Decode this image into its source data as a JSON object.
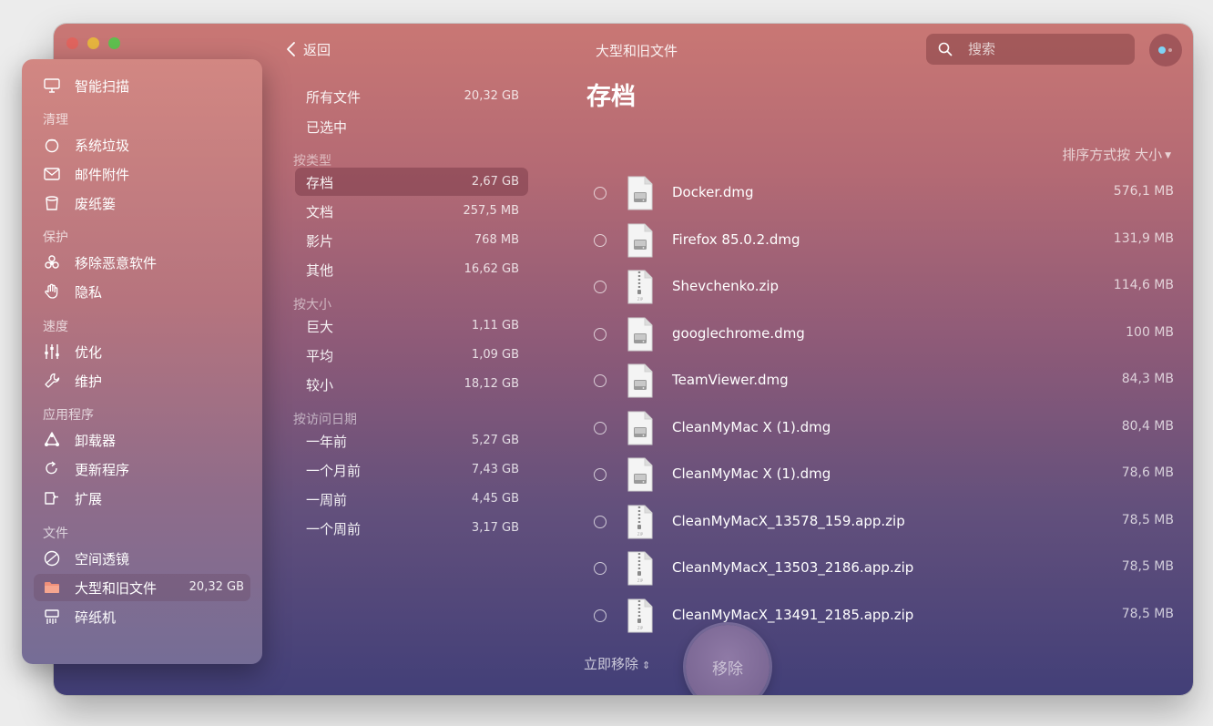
{
  "window": {
    "back_label": "返回",
    "title": "大型和旧文件",
    "search_placeholder": "搜索"
  },
  "sidebar": {
    "top_item": {
      "label": "智能扫描",
      "icon": "smart-scan-icon"
    },
    "sections": [
      {
        "heading": "清理",
        "items": [
          {
            "label": "系统垃圾",
            "icon": "system-junk-icon"
          },
          {
            "label": "邮件附件",
            "icon": "mail-icon"
          },
          {
            "label": "废纸篓",
            "icon": "trash-icon"
          }
        ]
      },
      {
        "heading": "保护",
        "items": [
          {
            "label": "移除恶意软件",
            "icon": "biohazard-icon"
          },
          {
            "label": "隐私",
            "icon": "hand-icon"
          }
        ]
      },
      {
        "heading": "速度",
        "items": [
          {
            "label": "优化",
            "icon": "sliders-icon"
          },
          {
            "label": "维护",
            "icon": "wrench-icon"
          }
        ]
      },
      {
        "heading": "应用程序",
        "items": [
          {
            "label": "卸载器",
            "icon": "uninstaller-icon"
          },
          {
            "label": "更新程序",
            "icon": "updater-icon"
          },
          {
            "label": "扩展",
            "icon": "extensions-icon"
          }
        ]
      },
      {
        "heading": "文件",
        "items": [
          {
            "label": "空间透镜",
            "icon": "space-lens-icon"
          },
          {
            "label": "大型和旧文件",
            "value": "20,32 GB",
            "icon": "folder-icon",
            "active": true
          },
          {
            "label": "碎纸机",
            "icon": "shredder-icon"
          }
        ]
      }
    ]
  },
  "categories": {
    "all": {
      "label": "所有文件",
      "value": "20,32 GB"
    },
    "selected": {
      "label": "已选中"
    },
    "by_type": {
      "heading": "按类型",
      "items": [
        {
          "label": "存档",
          "value": "2,67 GB",
          "active": true
        },
        {
          "label": "文档",
          "value": "257,5 MB"
        },
        {
          "label": "影片",
          "value": "768 MB"
        },
        {
          "label": "其他",
          "value": "16,62 GB"
        }
      ]
    },
    "by_size": {
      "heading": "按大小",
      "items": [
        {
          "label": "巨大",
          "value": "1,11 GB"
        },
        {
          "label": "平均",
          "value": "1,09 GB"
        },
        {
          "label": "较小",
          "value": "18,12 GB"
        }
      ]
    },
    "by_date": {
      "heading": "按访问日期",
      "items": [
        {
          "label": "一年前",
          "value": "5,27 GB"
        },
        {
          "label": "一个月前",
          "value": "7,43 GB"
        },
        {
          "label": "一周前",
          "value": "4,45 GB"
        },
        {
          "label": "一个周前",
          "value": "3,17 GB"
        }
      ]
    }
  },
  "main": {
    "section_title": "存档",
    "sort_label": "排序方式按 大小",
    "files": [
      {
        "name": "Docker.dmg",
        "size": "576,1 MB",
        "kind": "dmg"
      },
      {
        "name": "Firefox 85.0.2.dmg",
        "size": "131,9 MB",
        "kind": "dmg"
      },
      {
        "name": "Shevchenko.zip",
        "size": "114,6 MB",
        "kind": "zip"
      },
      {
        "name": "googlechrome.dmg",
        "size": "100 MB",
        "kind": "dmg"
      },
      {
        "name": "TeamViewer.dmg",
        "size": "84,3 MB",
        "kind": "dmg"
      },
      {
        "name": "CleanMyMac X (1).dmg",
        "size": "80,4 MB",
        "kind": "dmg"
      },
      {
        "name": "CleanMyMac X (1).dmg",
        "size": "78,6 MB",
        "kind": "dmg"
      },
      {
        "name": "CleanMyMacX_13578_159.app.zip",
        "size": "78,5 MB",
        "kind": "zip"
      },
      {
        "name": "CleanMyMacX_13503_2186.app.zip",
        "size": "78,5 MB",
        "kind": "zip"
      },
      {
        "name": "CleanMyMacX_13491_2185.app.zip",
        "size": "78,5 MB",
        "kind": "zip"
      }
    ],
    "remove_now_label": "立即移除",
    "remove_button_label": "移除"
  }
}
